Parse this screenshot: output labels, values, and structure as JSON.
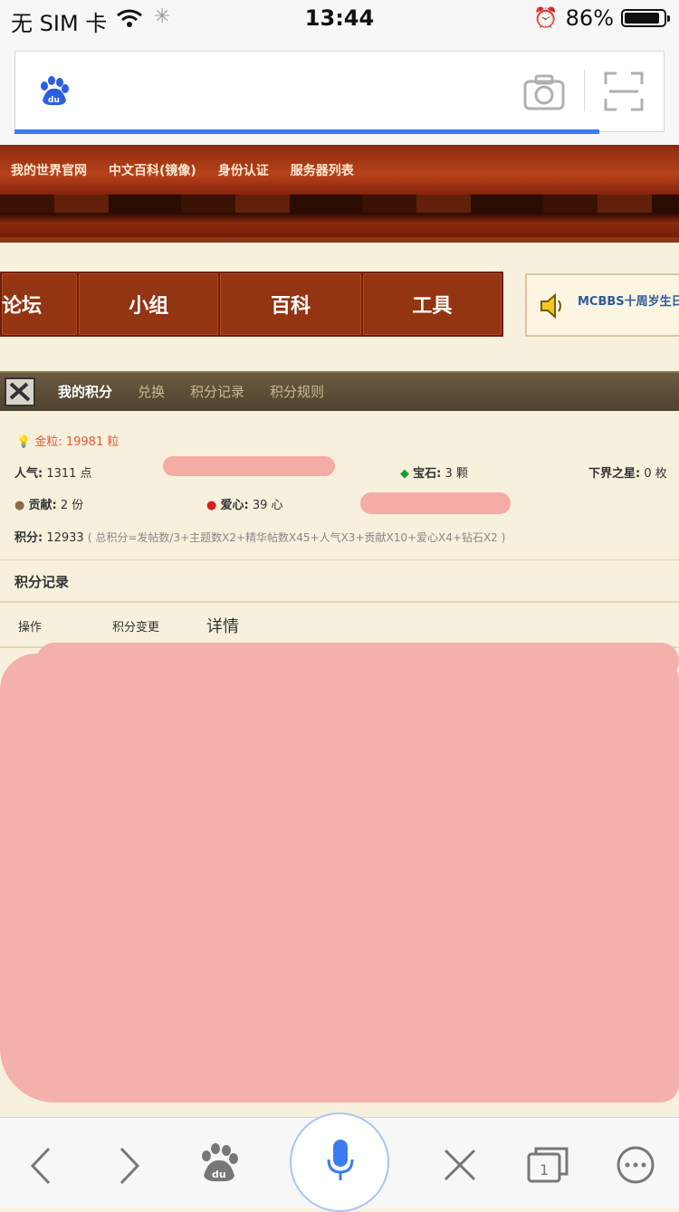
{
  "status_bar": {
    "carrier": "无 SIM 卡",
    "time": "13:44",
    "battery": "86%"
  },
  "site_header": {
    "links": [
      "我的世界官网",
      "中文百科(镜像)",
      "身份认证",
      "服务器列表"
    ]
  },
  "nav": {
    "items": [
      "论坛",
      "小组",
      "百科",
      "工具"
    ]
  },
  "notice": {
    "text": "MCBBS十周岁生日"
  },
  "points_tabs": [
    "我的积分",
    "兑换",
    "积分记录",
    "积分规则"
  ],
  "stats": {
    "gold_label": "金粒:",
    "gold_value": "19981 粒",
    "popularity_label": "人气:",
    "popularity_value": "1311 点",
    "gem_label": "宝石:",
    "gem_value": "3 颗",
    "nether_label": "下界之星:",
    "nether_value": "0 枚",
    "contribution_label": "贡献:",
    "contribution_value": "2 份",
    "love_label": "爱心:",
    "love_value": "39 心",
    "score_label": "积分:",
    "score_value": "12933",
    "score_formula": "( 总积分=发帖数/3+主题数X2+精华帖数X45+人气X3+贡献X10+爱心X4+钻石X2 )"
  },
  "record": {
    "title": "积分记录",
    "columns": [
      "操作",
      "积分变更",
      "详情"
    ]
  },
  "colors": {
    "accent": "#3b7cf0",
    "nav_bg": "#933412",
    "redaction": "#f4a8a2"
  }
}
